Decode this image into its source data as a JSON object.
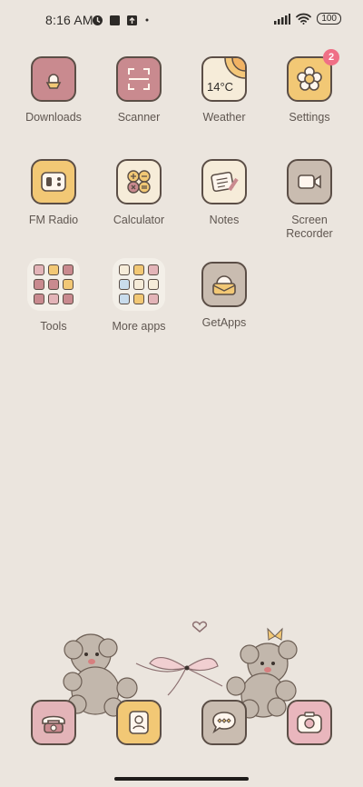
{
  "status": {
    "time": "8:16 AM",
    "battery": "100",
    "icons": [
      "notification-icon",
      "square-icon",
      "arrow-up-box-icon",
      "dot-icon",
      "signal-icon",
      "wifi-icon",
      "battery-icon"
    ]
  },
  "apps": [
    {
      "label": "Downloads",
      "color": "#c98a8f",
      "icon": "download-icon"
    },
    {
      "label": "Scanner",
      "color": "#c98a8f",
      "icon": "scanner-icon"
    },
    {
      "label": "Weather",
      "color": "#f6ecd9",
      "icon": "weather-icon",
      "temp": "14°C"
    },
    {
      "label": "Settings",
      "color": "#f2c875",
      "icon": "gear-icon",
      "badge": "2"
    },
    {
      "label": "FM Radio",
      "color": "#f2c875",
      "icon": "radio-icon"
    },
    {
      "label": "Calculator",
      "color": "#f6ecd9",
      "icon": "calculator-icon"
    },
    {
      "label": "Notes",
      "color": "#f6ecd9",
      "icon": "notes-icon"
    },
    {
      "label": "Screen\nRecorder",
      "color": "#c9bcb0",
      "icon": "video-camera-icon"
    },
    {
      "label": "Tools",
      "folder": true
    },
    {
      "label": "More apps",
      "folder": true
    },
    {
      "label": "GetApps",
      "color": "#c9bcb0",
      "icon": "shop-icon"
    }
  ],
  "dock": [
    {
      "name": "phone",
      "color": "#e3b4b8",
      "icon": "phone-icon"
    },
    {
      "name": "contacts",
      "color": "#f2c875",
      "icon": "contacts-icon"
    },
    {
      "name": "messages",
      "color": "#c9bcb0",
      "icon": "message-icon"
    },
    {
      "name": "camera",
      "color": "#e9b6bd",
      "icon": "camera-icon"
    }
  ]
}
